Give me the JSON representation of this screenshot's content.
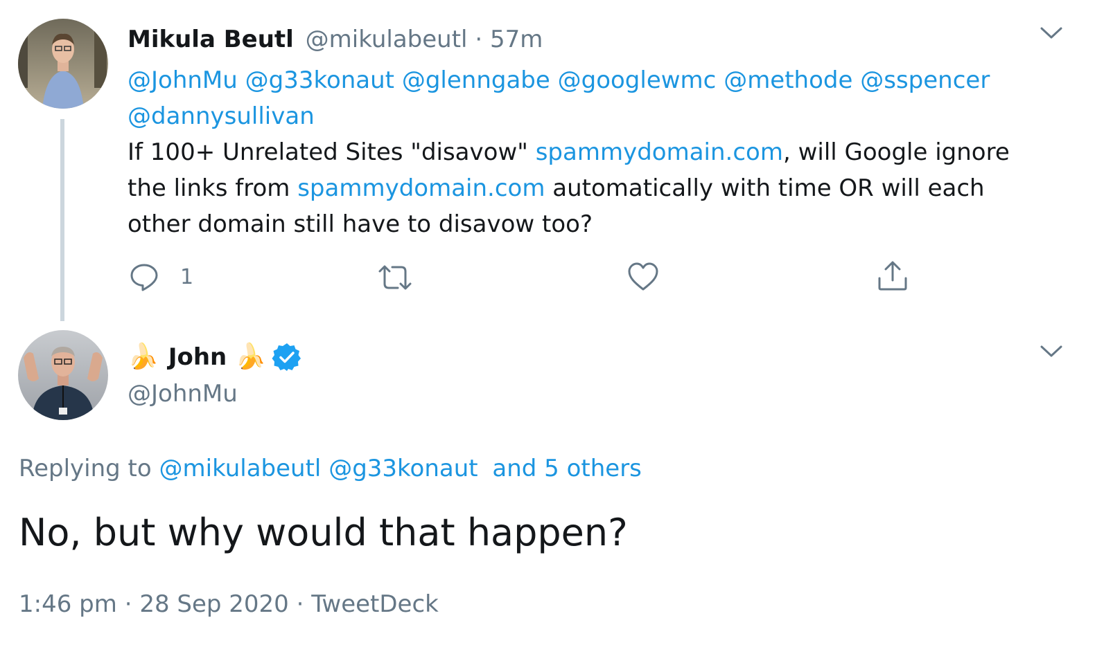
{
  "tweet1": {
    "author_name": "Mikula Beutl",
    "handle": "@mikulabeutl",
    "separator": "·",
    "time": "57m",
    "mentions_line1": [
      "@JohnMu",
      "@g33konaut",
      "@glenngabe",
      "@googlewmc",
      "@methode",
      "@sspencer"
    ],
    "mentions_line2": [
      "@dannysullivan"
    ],
    "body_parts": {
      "p1": "If 100+ Unrelated Sites \"disavow\" ",
      "link1": "spammydomain.com",
      "p2": ", will Google ignore",
      "p3": "the links from ",
      "link2": "spammydomain.com",
      "p4": " automatically with time OR will each",
      "p5": "other domain still have to disavow too?"
    },
    "reply_count": "1"
  },
  "tweet2": {
    "emoji_left": "🍌",
    "author_name": "John",
    "emoji_right": "🍌",
    "verified_icon": "verified-badge-icon",
    "handle": "@JohnMu",
    "replying_label": "Replying to",
    "replying_to": [
      "@mikulabeutl",
      "@g33konaut"
    ],
    "others": "and 5 others",
    "body": "No, but why would that happen?",
    "time": "1:46 pm",
    "separator1": "·",
    "date": "28 Sep 2020",
    "separator2": "·",
    "source": "TweetDeck"
  },
  "colors": {
    "link": "#1b95e0",
    "muted": "#657786",
    "text": "#14171a",
    "verified": "#1da1f2",
    "thread_line": "#ccd6dd"
  }
}
